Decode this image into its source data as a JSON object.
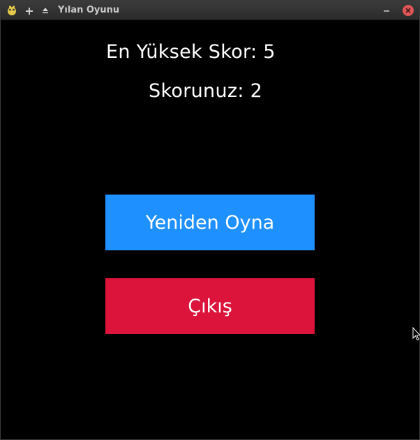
{
  "window": {
    "title": "Yılan Oyunu",
    "icons": [
      "app-icon",
      "plus-icon",
      "eject-icon",
      "minimize-icon",
      "close-icon"
    ]
  },
  "game": {
    "high_score_text": "En Yüksek Skor: 5",
    "your_score_text": "Skorunuz: 2",
    "high_score": 5,
    "score": 2
  },
  "buttons": {
    "replay_label": "Yeniden Oyna",
    "exit_label": "Çıkış"
  },
  "colors": {
    "background": "#000000",
    "replay_button": "#1e90ff",
    "exit_button": "#dc143c",
    "text": "#ffffff"
  }
}
